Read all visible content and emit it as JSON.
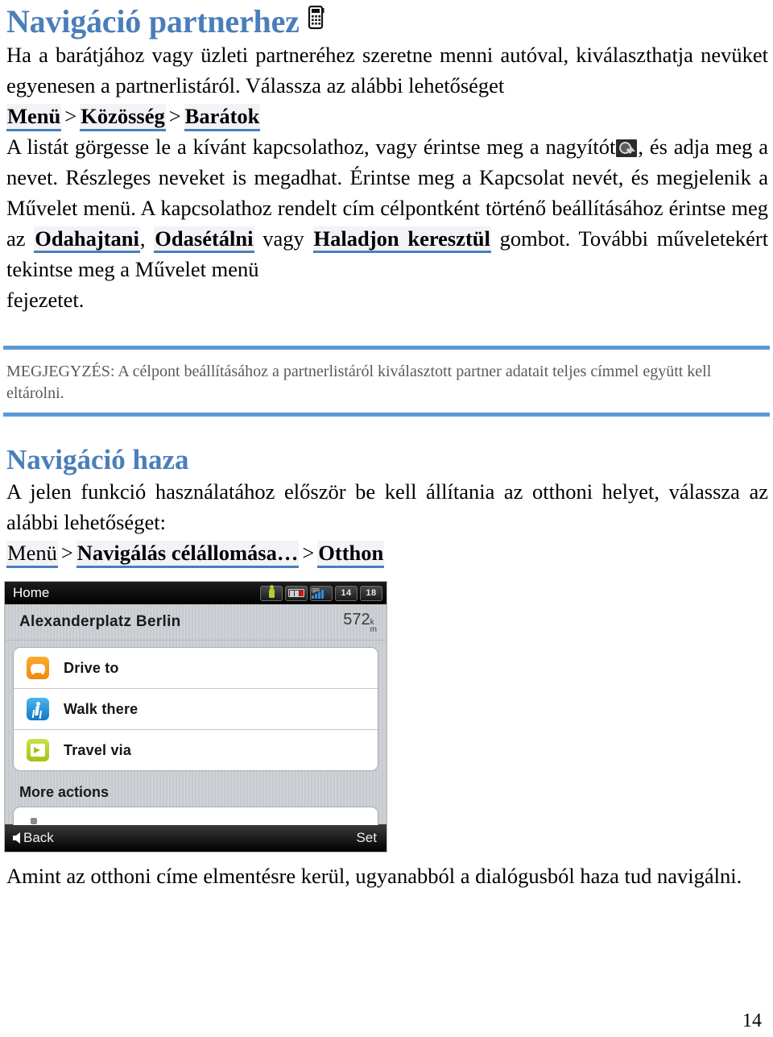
{
  "document": {
    "page_number": "14"
  },
  "section1": {
    "heading": "Navigáció partnerhez",
    "heading_icon": "mobile-phone-icon",
    "para1": "Ha a barátjához vagy üzleti partneréhez szeretne menni autóval, kiválaszthatja nevüket egyenesen a partnerlistáról. Válassza az alábbi lehetőséget",
    "path": {
      "item1": "Menü",
      "sep1": ">",
      "item2": "Közösség",
      "sep2": ">",
      "item3": "Barátok"
    },
    "para2_a": "A listát görgesse le a kívánt kapcsolathoz, vagy érintse meg a nagyítót",
    "para2_icon": "magnifier-icon",
    "para2_b": ", és adja meg a nevet. Részleges neveket is megadhat. Érintse meg a Kapcsolat nevét, és megjelenik a Művelet menü. A kapcsolathoz rendelt cím célpontként történő beállításához érintse meg az",
    "btn1": "Odahajtani",
    "comma": ",",
    "btn2": "Odasétálni",
    "para2_c": "vagy",
    "btn3": "Haladjon keresztül",
    "para2_d": "gombot. További műveletekért tekintse meg a Művelet menü",
    "para2_e": "fejezetet.",
    "note": "MEGJEGYZÉS: A célpont beállításához a partnerlistáról kiválasztott partner adatait teljes címmel együtt kell eltárolni."
  },
  "section2": {
    "heading": "Navigáció haza",
    "para1": "A jelen funkció használatához először be kell állítania az otthoni helyet, válassza az alábbi lehetőséget:",
    "path": {
      "item1": "Menü",
      "sep1": ">",
      "item2": "Navigálás célállomása…",
      "sep2": ">",
      "item3": "Otthon"
    },
    "closing": "Amint az otthoni címe elmentésre kerül, ugyanabból a dialógusból haza tud navigálni."
  },
  "device_screenshot": {
    "titlebar": {
      "title": "Home",
      "status_icons": [
        {
          "name": "pedestrian-status-icon",
          "label": ""
        },
        {
          "name": "battery-status-icon",
          "label": ""
        },
        {
          "name": "gps-signal-icon",
          "label": "gps"
        },
        {
          "name": "satellites-count-icon",
          "label": "14"
        },
        {
          "name": "time-icon",
          "label": "18"
        }
      ]
    },
    "destination": {
      "name": "Alexanderplatz Berlin",
      "distance_value": "572",
      "distance_unit_top": "k",
      "distance_unit_bottom": "m"
    },
    "actions": [
      {
        "label": "Drive to",
        "icon": "car-icon"
      },
      {
        "label": "Walk there",
        "icon": "pedestrian-icon"
      },
      {
        "label": "Travel via",
        "icon": "waypoint-flag-icon"
      }
    ],
    "more_actions_header": "More actions",
    "bottom_bar": {
      "back_label": "Back",
      "back_icon": "back-arrow-icon",
      "set_label": "Set"
    }
  },
  "colors": {
    "heading_blue": "#4a7ebb",
    "rule_blue": "#5b9bd5",
    "link_underline": "#4a7ebb",
    "link_bg": "#f2f2f7",
    "note_text": "#5a5a5a"
  }
}
